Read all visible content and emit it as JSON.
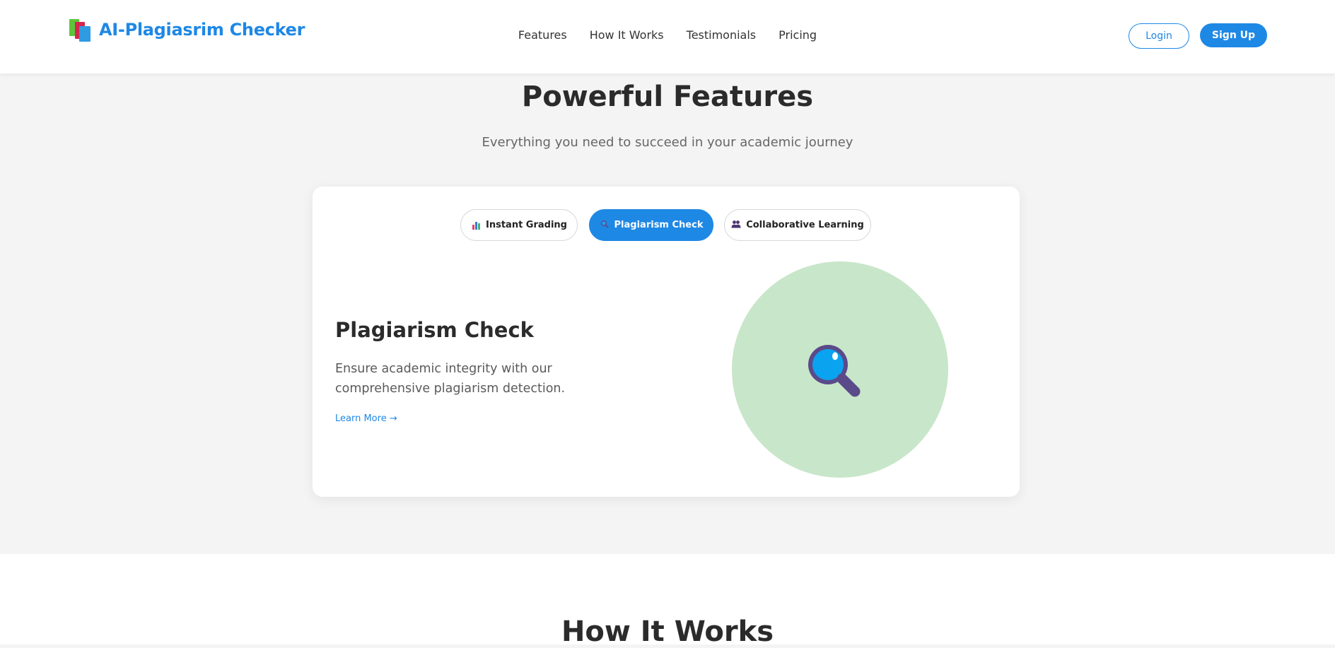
{
  "header": {
    "brand": "AI-Plagiasrim Checker",
    "nav": [
      "Features",
      "How It Works",
      "Testimonials",
      "Pricing"
    ],
    "login_label": "Login",
    "signup_label": "Sign Up"
  },
  "features": {
    "title": "Powerful Features",
    "subtitle": "Everything you need to succeed in your academic journey",
    "tabs": [
      {
        "label": "Instant Grading",
        "icon": "bar-chart-icon",
        "active": false
      },
      {
        "label": "Plagiarism Check",
        "icon": "magnifier-icon",
        "active": true
      },
      {
        "label": "Collaborative Learning",
        "icon": "people-icon",
        "active": false
      }
    ],
    "panel": {
      "heading": "Plagiarism Check",
      "description": "Ensure academic integrity with our comprehensive plagiarism detection.",
      "learn_more": "Learn More →",
      "illustration": "magnifier-icon"
    }
  },
  "how_it_works": {
    "title": "How It Works"
  },
  "colors": {
    "accent": "#1e88e5",
    "background": "#f4f4f4",
    "illustration_bg": "#c8e6c9"
  }
}
